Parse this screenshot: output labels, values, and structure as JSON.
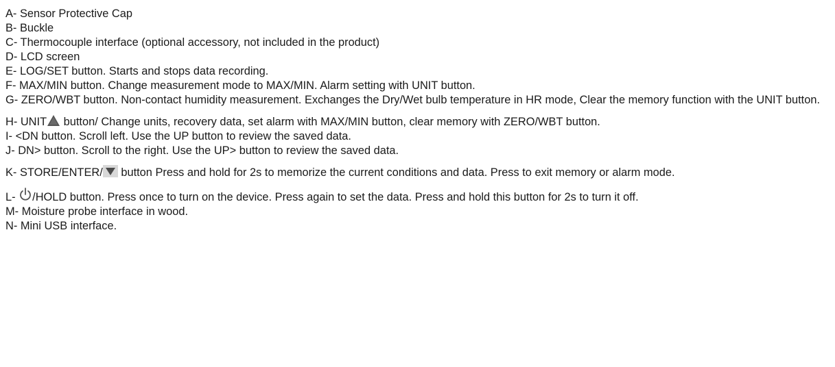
{
  "items": {
    "a": "A- Sensor Protective Cap",
    "b": "B- Buckle",
    "c": "C- Thermocouple interface (optional accessory, not included in the product)",
    "d": "D- LCD screen",
    "e": "E- LOG/SET button. Starts and stops data recording.",
    "f": "F- MAX/MIN button. Change measurement mode to MAX/MIN. Alarm setting with UNIT button.",
    "g": "G- ZERO/WBT button. Non-contact humidity measurement. Exchanges the Dry/Wet bulb temperature in HR mode, Clear the memory function with the UNIT button.",
    "h_prefix": "H- UNIT",
    "h_suffix": " button/ Change units, recovery data, set alarm with MAX/MIN button, clear memory with ZERO/WBT button.",
    "i": "I- <DN button. Scroll left. Use the UP button to review the saved data.",
    "j": "J- DN> button. Scroll to the right. Use the UP> button to review the saved data.",
    "k_prefix": "K- STORE/ENTER/",
    "k_suffix": " button Press and hold for 2s to memorize the current conditions and data. Press to exit memory or alarm mode.",
    "l_prefix": "L- ",
    "l_suffix": "/HOLD button. Press once to turn on the device. Press again to set the data. Press and hold this button for 2s to turn it off.",
    "m": "M- Moisture probe interface in wood.",
    "n": "N- Mini USB interface."
  },
  "icons": {
    "up": "up-triangle-icon",
    "down": "down-triangle-icon",
    "power": "power-icon"
  },
  "colors": {
    "text": "#1a1a1a",
    "icon_fill": "#4a4a4a",
    "icon_bg": "#d8d8d8"
  }
}
